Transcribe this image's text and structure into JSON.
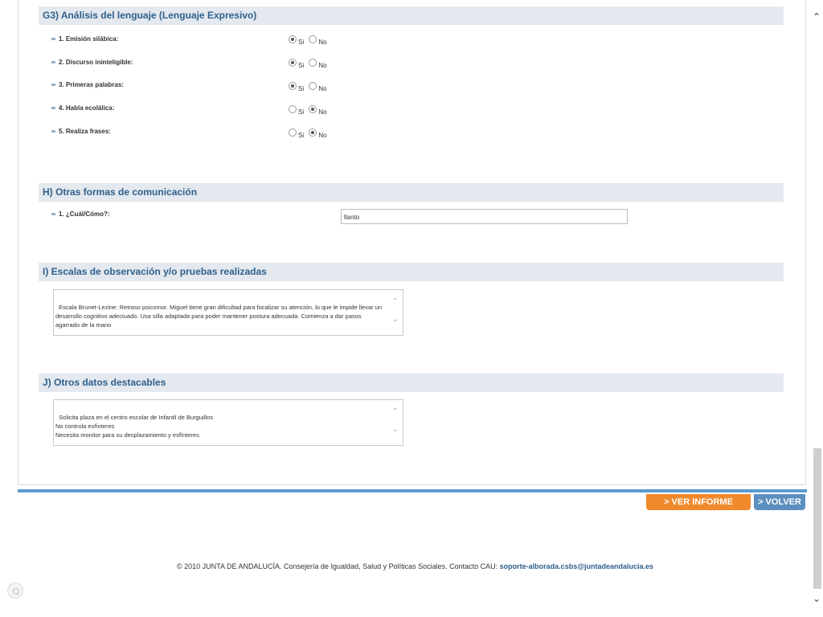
{
  "sections": {
    "g3": {
      "title": "G3) Análisis del lenguaje (Lenguaje Expresivo)",
      "questions": [
        {
          "label": "1. Emisión silábica:",
          "yes": "Si",
          "no": "No",
          "selected": "yes"
        },
        {
          "label": "2. Discurso ininteligible:",
          "yes": "Si",
          "no": "No",
          "selected": "yes"
        },
        {
          "label": "3. Primeras palabras:",
          "yes": "Si",
          "no": "No",
          "selected": "yes"
        },
        {
          "label": "4. Habla ecolálica:",
          "yes": "Si",
          "no": "No",
          "selected": "no"
        },
        {
          "label": "5. Realiza frases:",
          "yes": "Si",
          "no": "No",
          "selected": "no"
        }
      ]
    },
    "h": {
      "title": "H) Otras formas de comunicación",
      "question_label": "1. ¿Cuál/Cómo?:",
      "value": "llanto"
    },
    "i": {
      "title": "I) Escalas de observación y/o pruebas realizadas",
      "text": "Escala Brunet-Lezine: Retraso psicomor. Miguel tiene gran dificultad para focalizar su atención, lo que le impide llevar un desarrollo cognitivo adeciuado. Usa silla adaptada para poder mantener postura adecuada. Comienza a dar pasos agarrado de la mano"
    },
    "j": {
      "title": "J) Otros datos destacables",
      "text": "Solicita plaza en el centro escolar de Infantil de Burguillos\nNo controla esfínteres\nNecesita monitor para su desplazamiento y esfínteres"
    }
  },
  "buttons": {
    "report": "> VER INFORME",
    "back": "> VOLVER"
  },
  "footer": {
    "text": "© 2010 JUNTA DE ANDALUCÍA. Consejería de Igualdad, Salud y Políticas Sociales. Contacto CAU:",
    "email": "soporte-alborada.csbs@juntadeandalucia.es"
  },
  "colors": {
    "section_header_bg": "#e3e9ef",
    "section_header_text": "#2f5f8b",
    "accent_bar": "#5b9bd1",
    "report_button": "#f08a2c",
    "back_button": "#5b8fbf"
  }
}
